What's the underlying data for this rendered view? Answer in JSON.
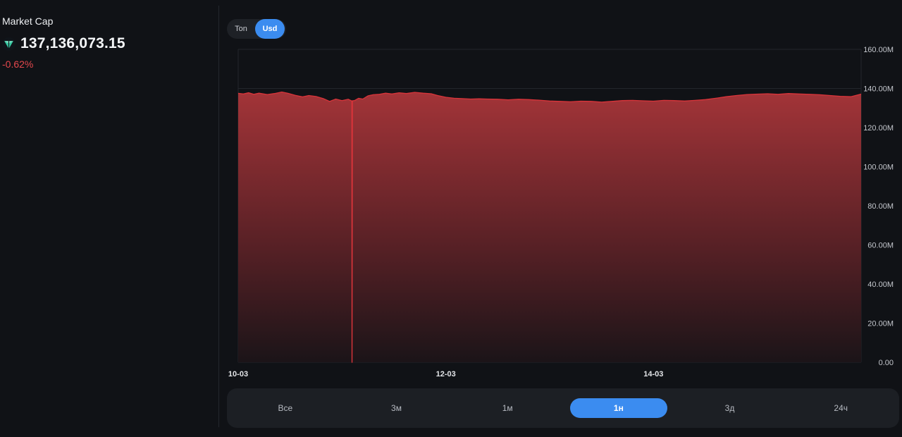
{
  "market_cap": {
    "title": "Market Cap",
    "value": "137,136,073.15",
    "change": "-0.62%",
    "currency_icon": "ton-diamond-icon",
    "change_color": "#e5484d"
  },
  "currency_toggle": {
    "options": [
      "Ton",
      "Usd"
    ],
    "selected": "Usd"
  },
  "range_selector": {
    "options": [
      "Все",
      "3м",
      "1м",
      "1н",
      "3д",
      "24ч"
    ],
    "selected": "1н"
  },
  "colors": {
    "accent": "#3b8cf0",
    "series": "#d9343a",
    "background": "#101216"
  },
  "chart_data": {
    "type": "area",
    "x_ticks": [
      "10-03",
      "12-03",
      "14-03"
    ],
    "y_ticks": [
      "0.00",
      "20.00M",
      "40.00M",
      "60.00M",
      "80.00M",
      "100.00M",
      "120.00M",
      "140.00M",
      "160.00M"
    ],
    "ylim": [
      0,
      160000000
    ],
    "xlim": [
      "10-03",
      "16-03"
    ],
    "x_unit": "days",
    "grid": true,
    "series": [
      {
        "points": [
          [
            0.0,
            137.5
          ],
          [
            0.05,
            137.2
          ],
          [
            0.1,
            137.8
          ],
          [
            0.15,
            137.0
          ],
          [
            0.2,
            137.6
          ],
          [
            0.28,
            136.9
          ],
          [
            0.35,
            137.4
          ],
          [
            0.42,
            138.2
          ],
          [
            0.48,
            137.5
          ],
          [
            0.55,
            136.5
          ],
          [
            0.62,
            135.7
          ],
          [
            0.68,
            136.4
          ],
          [
            0.75,
            135.9
          ],
          [
            0.82,
            134.8
          ],
          [
            0.88,
            133.4
          ],
          [
            0.94,
            134.6
          ],
          [
            1.0,
            133.8
          ],
          [
            1.06,
            134.5
          ],
          [
            1.1,
            133.7
          ],
          [
            1.095,
            133.6
          ],
          [
            1.096,
            0.0
          ],
          [
            1.097,
            0.0
          ],
          [
            1.12,
            133.8
          ],
          [
            1.16,
            135.0
          ],
          [
            1.2,
            134.6
          ],
          [
            1.25,
            136.2
          ],
          [
            1.3,
            136.8
          ],
          [
            1.36,
            137.0
          ],
          [
            1.42,
            137.6
          ],
          [
            1.48,
            137.2
          ],
          [
            1.55,
            137.8
          ],
          [
            1.62,
            137.4
          ],
          [
            1.7,
            138.0
          ],
          [
            1.78,
            137.6
          ],
          [
            1.86,
            137.3
          ],
          [
            1.92,
            136.4
          ],
          [
            2.0,
            135.5
          ],
          [
            2.08,
            135.0
          ],
          [
            2.16,
            134.8
          ],
          [
            2.24,
            134.6
          ],
          [
            2.32,
            134.7
          ],
          [
            2.4,
            134.6
          ],
          [
            2.5,
            134.5
          ],
          [
            2.6,
            134.2
          ],
          [
            2.7,
            134.5
          ],
          [
            2.8,
            134.3
          ],
          [
            2.9,
            134.0
          ],
          [
            3.0,
            133.6
          ],
          [
            3.1,
            133.4
          ],
          [
            3.2,
            133.2
          ],
          [
            3.3,
            133.5
          ],
          [
            3.4,
            133.4
          ],
          [
            3.5,
            133.0
          ],
          [
            3.6,
            133.4
          ],
          [
            3.7,
            133.8
          ],
          [
            3.8,
            133.9
          ],
          [
            3.9,
            133.7
          ],
          [
            4.0,
            133.5
          ],
          [
            4.1,
            133.9
          ],
          [
            4.2,
            133.8
          ],
          [
            4.3,
            133.6
          ],
          [
            4.4,
            133.9
          ],
          [
            4.5,
            134.3
          ],
          [
            4.6,
            135.0
          ],
          [
            4.7,
            135.8
          ],
          [
            4.8,
            136.4
          ],
          [
            4.9,
            136.9
          ],
          [
            5.0,
            137.1
          ],
          [
            5.1,
            137.3
          ],
          [
            5.2,
            137.0
          ],
          [
            5.3,
            137.4
          ],
          [
            5.4,
            137.2
          ],
          [
            5.5,
            137.0
          ],
          [
            5.6,
            136.8
          ],
          [
            5.7,
            136.4
          ],
          [
            5.8,
            136.0
          ],
          [
            5.9,
            135.8
          ],
          [
            6.0,
            137.1
          ]
        ]
      }
    ]
  }
}
